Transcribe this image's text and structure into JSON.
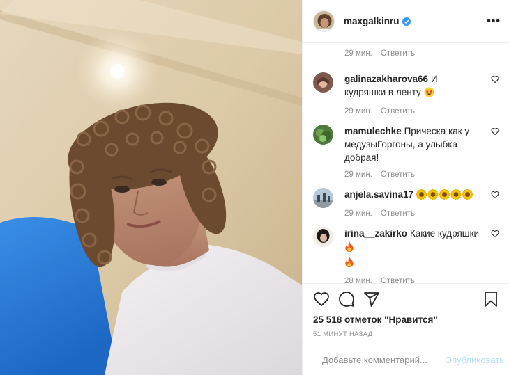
{
  "colors": {
    "text": "#262626",
    "secondary": "#8e8e8e",
    "verified": "#3897f0",
    "publish_disabled": "#b2dffc",
    "divider": "#efefef"
  },
  "post": {
    "author": "maxgalkinru",
    "verified": true,
    "more_icon": "ellipsis-icon",
    "first_meta": {
      "time": "29 мин.",
      "reply": "Ответить"
    },
    "comments": [
      {
        "user": "galinazakharova66",
        "text": "И кудряшки в ленту",
        "emoji": "star-struck",
        "time": "29 мин.",
        "reply": "Ответить"
      },
      {
        "user": "mamulechke",
        "text": "Прическа как у медузыГоргоны, а улыбка добрая!",
        "emoji": "",
        "time": "29 мин.",
        "reply": "Ответить"
      },
      {
        "user": "anjela.savina17",
        "text": "",
        "emoji": "sunflower x5",
        "time": "29 мин.",
        "reply": "Ответить"
      },
      {
        "user": "irina__zakirko",
        "text": "Какие кудряшки",
        "emoji": "fire x2",
        "time": "28 мин.",
        "reply": "Ответить"
      }
    ],
    "likes": "25 518 отметок \"Нравится\"",
    "time_ago": "51 МИНУТ НАЗАД",
    "add_comment": {
      "placeholder": "Добавьте комментарий...",
      "publish": "Опубликовать"
    },
    "icons": [
      "heart-icon",
      "comment-icon",
      "share-icon",
      "bookmark-icon",
      "smiley-icon"
    ]
  }
}
